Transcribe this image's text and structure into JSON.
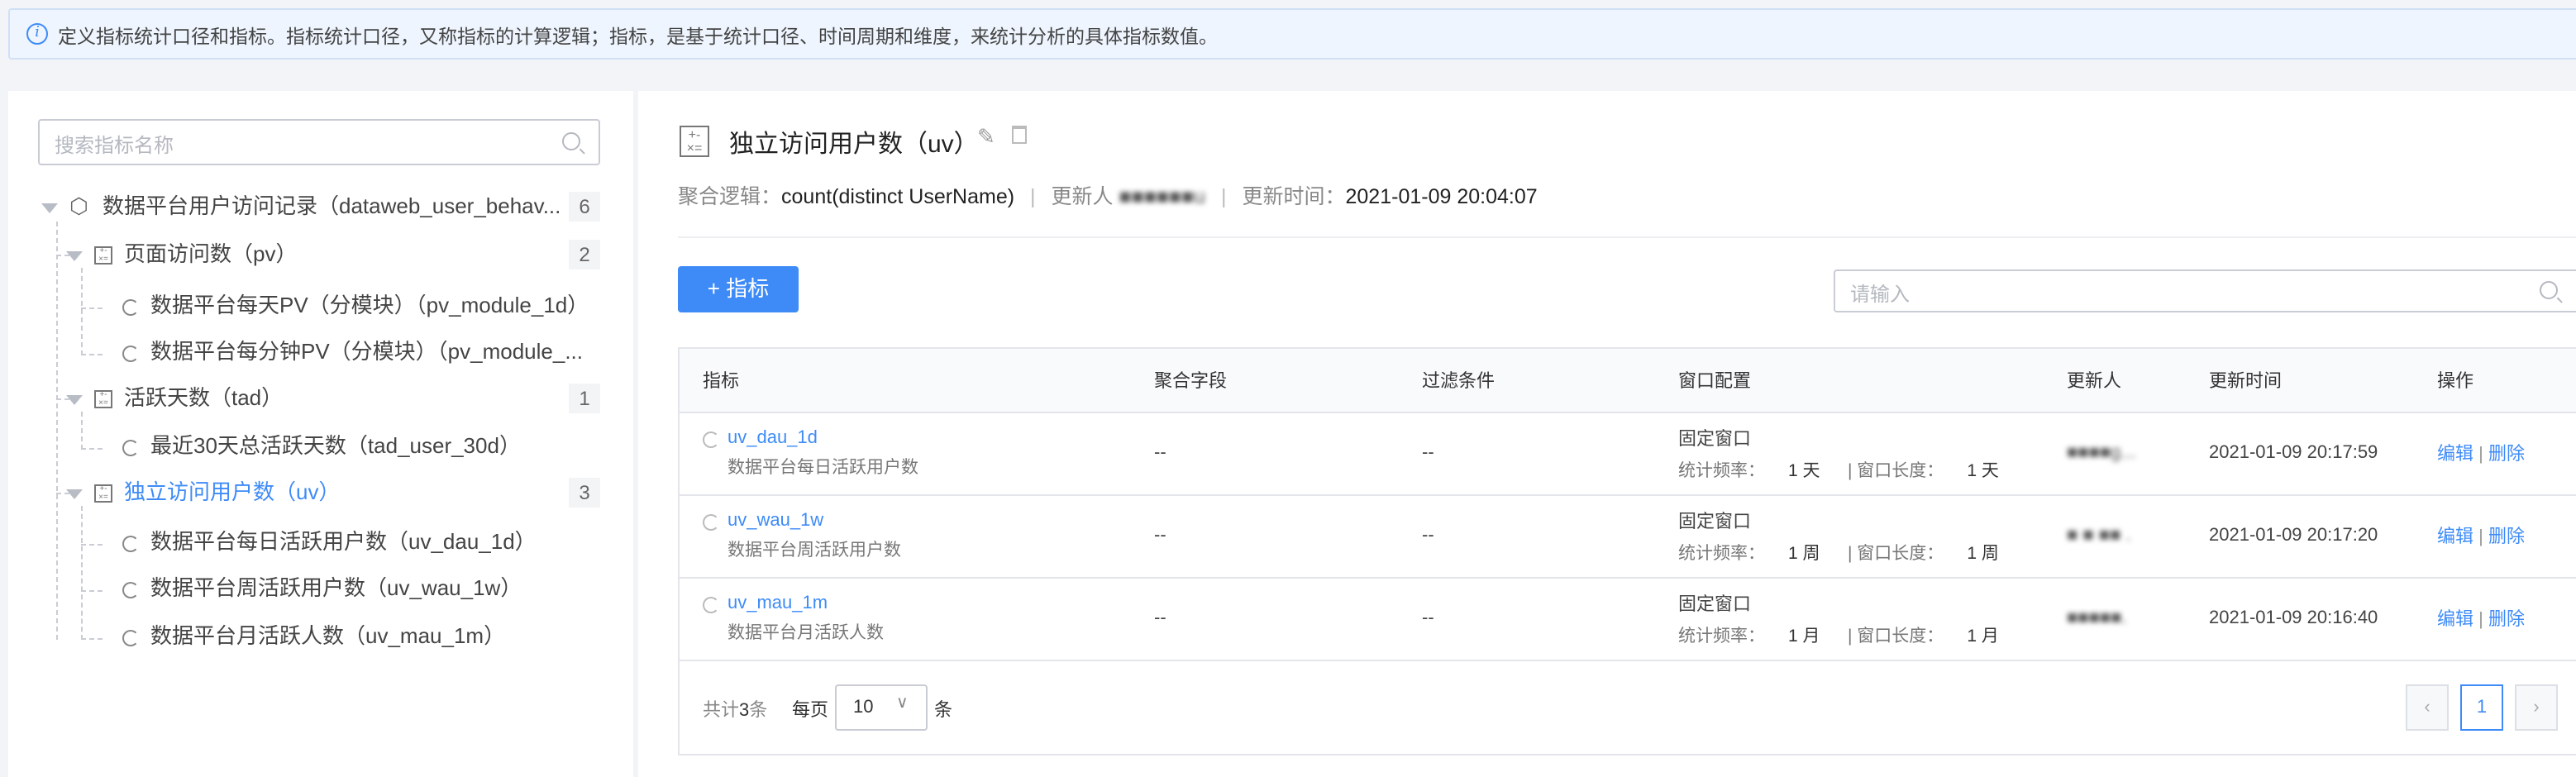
{
  "banner": {
    "text": "定义指标统计口径和指标。指标统计口径，又称指标的计算逻辑；指标，是基于统计口径、时间周期和维度，来统计分析的具体指标数值。"
  },
  "sidebar": {
    "search_placeholder": "搜索指标名称",
    "root": {
      "label": "数据平台用户访问记录（dataweb_user_behav...",
      "count": "6"
    },
    "groups": [
      {
        "label": "页面访问数（pv）",
        "count": "2",
        "items": [
          "数据平台每天PV（分模块）（pv_module_1d）",
          "数据平台每分钟PV（分模块）（pv_module_..."
        ]
      },
      {
        "label": "活跃天数（tad）",
        "count": "1",
        "items": [
          "最近30天总活跃天数（tad_user_30d）"
        ]
      },
      {
        "label": "独立访问用户数（uv）",
        "count": "3",
        "items": [
          "数据平台每日活跃用户数（uv_dau_1d）",
          "数据平台周活跃用户数（uv_wau_1w）",
          "数据平台月活跃人数（uv_mau_1m）"
        ]
      }
    ]
  },
  "detail": {
    "title": "独立访问用户数（uv）",
    "agg_label": "聚合逻辑：",
    "agg_value": "count(distinct UserName)",
    "sep": "|",
    "updater_label": "更新人",
    "updater_value": "■■■■■■u",
    "time_label": "更新时间：",
    "time_value": "2021-01-09 20:04:07",
    "add_button": "+ 指标",
    "search_placeholder": "请输入"
  },
  "table": {
    "headers": [
      "指标",
      "聚合字段",
      "过滤条件",
      "窗口配置",
      "更新人",
      "更新时间",
      "操作"
    ],
    "rows": [
      {
        "name": "uv_dau_1d",
        "desc": "数据平台每日活跃用户数",
        "agg": "--",
        "filter": "--",
        "window": "固定窗口",
        "freq_label": "统计频率：",
        "freq": "1 天",
        "len_label": "| 窗口长度：",
        "len": "1 天",
        "updater": "■■■■g...",
        "time": "2021-01-09 20:17:59",
        "edit": "编辑",
        "del": "删除"
      },
      {
        "name": "uv_wau_1w",
        "desc": "数据平台周活跃用户数",
        "agg": "--",
        "filter": "--",
        "window": "固定窗口",
        "freq_label": "统计频率：",
        "freq": "1 周",
        "len_label": "| 窗口长度：",
        "len": "1 周",
        "updater": "■ ■ ■■ .",
        "time": "2021-01-09 20:17:20",
        "edit": "编辑",
        "del": "删除"
      },
      {
        "name": "uv_mau_1m",
        "desc": "数据平台月活跃人数",
        "agg": "--",
        "filter": "--",
        "window": "固定窗口",
        "freq_label": "统计频率：",
        "freq": "1 月",
        "len_label": "| 窗口长度：",
        "len": "1 月",
        "updater": "■■■■■.",
        "time": "2021-01-09 20:16:40",
        "edit": "编辑",
        "del": "删除"
      }
    ],
    "total_prefix": "共计",
    "total": "3",
    "total_suffix": "条",
    "per_page_label": "每页",
    "per_page": "10",
    "per_page_suffix": "条",
    "page": "1",
    "prev": "‹",
    "next": "›"
  },
  "colors": {
    "accent": "#3e8bf7"
  }
}
